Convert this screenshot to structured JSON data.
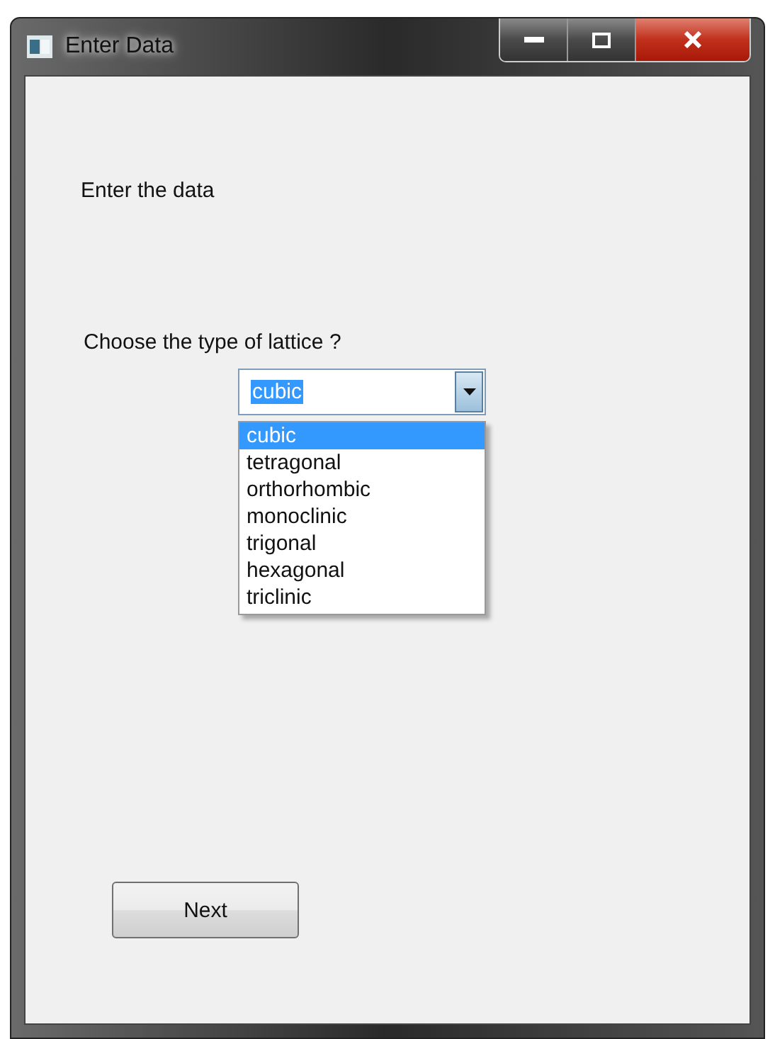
{
  "window": {
    "title": "Enter Data"
  },
  "prompt": "Enter the data",
  "question": "Choose the type of lattice ?",
  "combo": {
    "value": "cubic",
    "open": true,
    "options": [
      {
        "label": "cubic",
        "selected": true
      },
      {
        "label": "tetragonal",
        "selected": false
      },
      {
        "label": "orthorhombic",
        "selected": false
      },
      {
        "label": "monoclinic",
        "selected": false
      },
      {
        "label": "trigonal",
        "selected": false
      },
      {
        "label": "hexagonal",
        "selected": false
      },
      {
        "label": "triclinic",
        "selected": false
      }
    ]
  },
  "buttons": [
    "Next"
  ]
}
